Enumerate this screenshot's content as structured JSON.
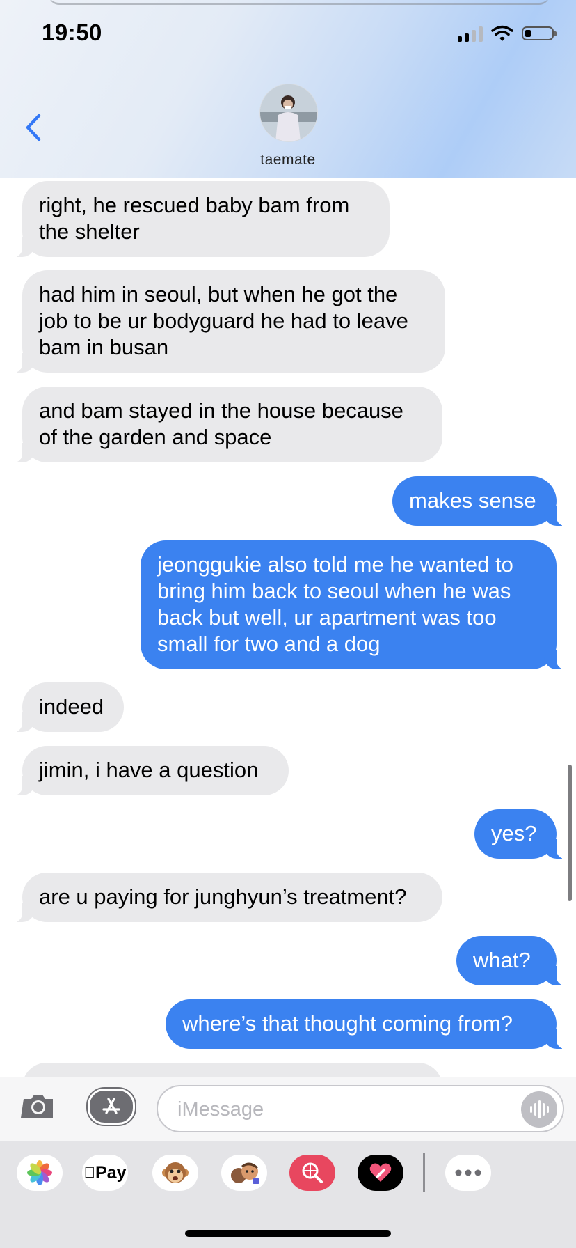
{
  "status_bar": {
    "time": "19:50"
  },
  "header": {
    "contact_name": "taemate"
  },
  "messages": [
    {
      "from": "them",
      "text": "right, he rescued baby bam from\nthe shelter"
    },
    {
      "from": "them",
      "text": "had him in seoul, but when he got the\njob to be ur bodyguard he had to leave\nbam in busan"
    },
    {
      "from": "them",
      "text": "and bam stayed in the house because\nof the garden and space"
    },
    {
      "from": "me",
      "text": "makes sense"
    },
    {
      "from": "me",
      "text": "jeonggukie also told me he wanted to\nbring him back to seoul when he was\nback but well, ur apartment was too\nsmall for two and a dog"
    },
    {
      "from": "them",
      "text": "indeed"
    },
    {
      "from": "them",
      "text": "jimin, i have a question"
    },
    {
      "from": "me",
      "text": "yes?"
    },
    {
      "from": "them",
      "text": "are u paying for junghyun’s treatment?"
    },
    {
      "from": "me",
      "text": "what?"
    },
    {
      "from": "me",
      "text": "where’s that thought coming from?"
    }
  ],
  "input": {
    "placeholder": "iMessage"
  },
  "app_drawer": {
    "apps": [
      {
        "icon": "photos-icon"
      },
      {
        "icon": "apple-pay-icon",
        "label": "Pay"
      },
      {
        "icon": "monkey-memoji-icon"
      },
      {
        "icon": "memoji-stickers-icon"
      },
      {
        "icon": "image-search-icon"
      },
      {
        "icon": "digital-touch-icon"
      },
      {
        "icon": "more-apps-icon"
      }
    ]
  },
  "colors": {
    "outgoing_bubble": "#3b82f0",
    "incoming_bubble": "#e9e9eb",
    "accent": "#3478f6"
  }
}
